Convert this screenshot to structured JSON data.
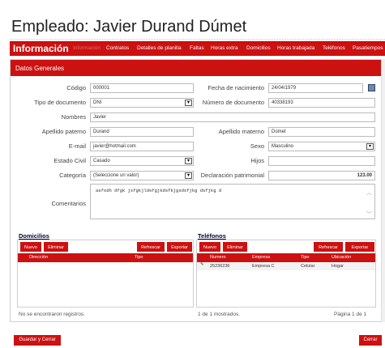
{
  "window": {
    "title": "Empleado: Javier Durand Dúmet"
  },
  "tabs": {
    "main_label": "Información",
    "items": [
      {
        "label": "Información"
      },
      {
        "label": "Contratos"
      },
      {
        "label": "Detalles de planilla"
      },
      {
        "label": "Faltas"
      },
      {
        "label": "Horas extra"
      },
      {
        "label": "Domicilios"
      },
      {
        "label": "Horas trabajada"
      },
      {
        "label": "Teléfonos"
      },
      {
        "label": "Pasatiempos"
      }
    ]
  },
  "panel": {
    "title": "Datos Generales"
  },
  "form": {
    "codigo_label": "Código",
    "codigo_value": "000001",
    "fecha_label": "Fecha de nacimiento",
    "fecha_value": "24/04/1979",
    "tipodoc_label": "Tipo de documento",
    "tipodoc_value": "DNI",
    "numdoc_label": "Número de documento",
    "numdoc_value": "40338193",
    "nombres_label": "Nombres",
    "nombres_value": "Javier",
    "apaterno_label": "Apellido paterno",
    "apaterno_value": "Durand",
    "amaterno_label": "Apellido materno",
    "amaterno_value": "Dúmet",
    "email_label": "E-mail",
    "email_value": "javier@hotmail.com",
    "sexo_label": "Sexo",
    "sexo_value": "Masculino",
    "civil_label": "Estado Civil",
    "civil_value": "Casado",
    "hijos_label": "Hijos",
    "hijos_value": "",
    "categoria_label": "Categoría",
    "categoria_value": "(Seleccione un valor)",
    "patrimonial_label": "Declaración patrimonial",
    "patrimonial_value": "123.00",
    "comentarios_label": "Comentarios",
    "comentarios_value": "asfsdh dfgk jsfgkjldsfgjkdsfkjgsdsfjkg dsfjkg d"
  },
  "domicilios": {
    "header": "Domicilios",
    "nuevo": "Nuevo",
    "eliminar": "Eliminar",
    "refrescar": "Refrescar",
    "exportar": "Exportar",
    "columns": [
      "Dirección",
      "Tipo"
    ],
    "footer": "No se encontraron registros"
  },
  "telefonos": {
    "header": "Teléfonos",
    "nuevo": "Nuevo",
    "eliminar": "Eliminar",
    "refrescar": "Refrescar",
    "exportar": "Exportar",
    "columns": [
      "Numero",
      "Empresa",
      "Tipo",
      "Ubicación"
    ],
    "rows": [
      {
        "numero": "25236236",
        "empresa": "Empresa C",
        "tipo": "Celular",
        "ubicacion": "Hogar"
      }
    ],
    "footer_left": "1 de 1 mostrados.",
    "footer_right": "Página 1 de 1"
  },
  "actions": {
    "save_close": "Guardar y Cerrar",
    "close": "Cerrar"
  },
  "colors": {
    "accent": "#cc1111"
  }
}
